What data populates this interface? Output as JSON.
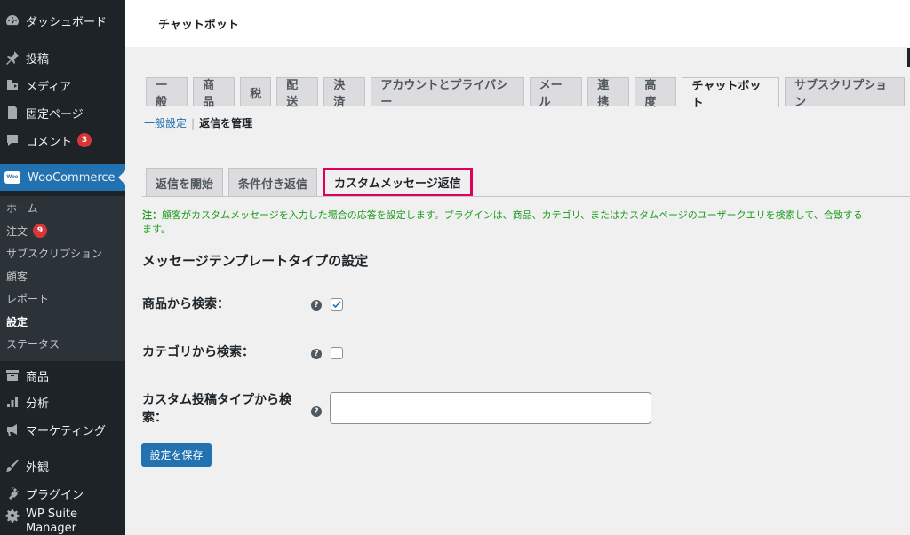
{
  "sidebar": {
    "items": [
      {
        "label": "ダッシュボード",
        "icon": "dashboard-icon"
      },
      {
        "label": "投稿",
        "icon": "pin-icon"
      },
      {
        "label": "メディア",
        "icon": "media-icon"
      },
      {
        "label": "固定ページ",
        "icon": "page-icon"
      },
      {
        "label": "コメント",
        "icon": "comment-icon",
        "badge": "3"
      },
      {
        "label": "WooCommerce",
        "icon": "woocommerce-logo",
        "logo_text": "Woo"
      },
      {
        "label": "商品",
        "icon": "archive-icon"
      },
      {
        "label": "分析",
        "icon": "bar-chart-icon"
      },
      {
        "label": "マーケティング",
        "icon": "megaphone-icon"
      },
      {
        "label": "外観",
        "icon": "brush-icon"
      },
      {
        "label": "プラグイン",
        "icon": "plugin-icon"
      },
      {
        "label": "WP Suite",
        "icon": "gear-icon",
        "label2": "Manager"
      }
    ],
    "submenu": [
      {
        "label": "ホーム"
      },
      {
        "label": "注文",
        "badge": "9"
      },
      {
        "label": "サブスクリプション"
      },
      {
        "label": "顧客"
      },
      {
        "label": "レポート"
      },
      {
        "label": "設定"
      },
      {
        "label": "ステータス"
      }
    ]
  },
  "header": {
    "title": "チャットボット"
  },
  "tabs": [
    "一般",
    "商品",
    "税",
    "配送",
    "決済",
    "アカウントとプライバシー",
    "メール",
    "連携",
    "高度",
    "チャットボット",
    "サブスクリプション"
  ],
  "subnav": {
    "general": "一般設定",
    "separator": "|",
    "current": "返信を管理"
  },
  "inner_tabs": [
    "返信を開始",
    "条件付き返信",
    "カスタムメッセージ返信"
  ],
  "note": {
    "prefix": "注：",
    "text": "顧客がカスタムメッセージを入力した場合の応答を設定します。プラグインは、商品、カテゴリ、またはカスタムページのユーザークエリを検索して、合致する",
    "text2": "ます。"
  },
  "section": {
    "title": "メッセージテンプレートタイプの設定"
  },
  "fields": {
    "product_search": {
      "label": "商品から検索：",
      "checked": true
    },
    "category_search": {
      "label": "カテゴリから検索：",
      "checked": false
    },
    "custom_post_type": {
      "label1": "カスタム投稿タイプから検",
      "label2": "索：",
      "value": ""
    }
  },
  "help_icon_glyph": "?",
  "save_button": "設定を保存",
  "colors": {
    "sidebar_bg": "#1d2327",
    "accent": "#2271b1",
    "highlight_border": "#e0005a",
    "note_green": "#1a9b1a",
    "badge_red": "#d63638"
  }
}
